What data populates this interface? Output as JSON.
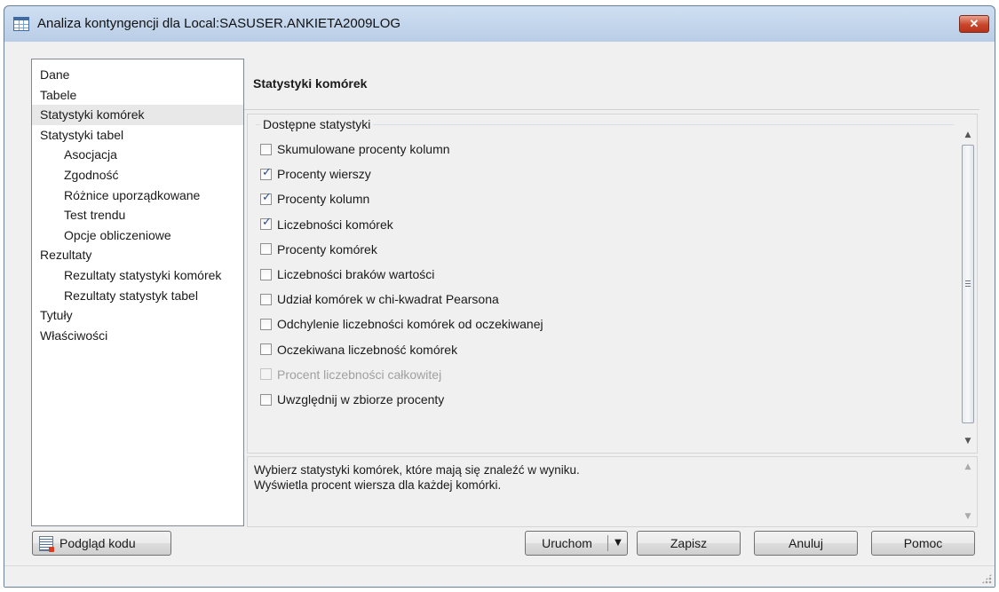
{
  "window": {
    "title": "Analiza kontyngencji dla Local:SASUSER.ANKIETA2009LOG",
    "close_label": "✕"
  },
  "nav": {
    "items": [
      {
        "label": "Dane",
        "level": 0
      },
      {
        "label": "Tabele",
        "level": 0
      },
      {
        "label": "Statystyki komórek",
        "level": 0,
        "selected": true
      },
      {
        "label": "Statystyki tabel",
        "level": 0
      },
      {
        "label": "Asocjacja",
        "level": 1
      },
      {
        "label": "Zgodność",
        "level": 1
      },
      {
        "label": "Różnice uporządkowane",
        "level": 1
      },
      {
        "label": "Test trendu",
        "level": 1
      },
      {
        "label": "Opcje obliczeniowe",
        "level": 1
      },
      {
        "label": "Rezultaty",
        "level": 0
      },
      {
        "label": "Rezultaty statystyki komórek",
        "level": 1
      },
      {
        "label": "Rezultaty statystyk tabel",
        "level": 1
      },
      {
        "label": "Tytuły",
        "level": 0
      },
      {
        "label": "Właściwości",
        "level": 0
      }
    ]
  },
  "main": {
    "title": "Statystyki komórek",
    "group_label": "Dostępne statystyki",
    "options": [
      {
        "label": "Skumulowane procenty kolumn",
        "checked": false,
        "enabled": true
      },
      {
        "label": "Procenty wierszy",
        "checked": true,
        "enabled": true
      },
      {
        "label": "Procenty kolumn",
        "checked": true,
        "enabled": true
      },
      {
        "label": "Liczebności komórek",
        "checked": true,
        "enabled": true
      },
      {
        "label": "Procenty komórek",
        "checked": false,
        "enabled": true
      },
      {
        "label": "Liczebności braków wartości",
        "checked": false,
        "enabled": true
      },
      {
        "label": "Udział komórek w chi-kwadrat Pearsona",
        "checked": false,
        "enabled": true
      },
      {
        "label": "Odchylenie liczebności komórek od oczekiwanej",
        "checked": false,
        "enabled": true
      },
      {
        "label": "Oczekiwana liczebność komórek",
        "checked": false,
        "enabled": true
      },
      {
        "label": "Procent liczebności całkowitej",
        "checked": false,
        "enabled": false
      },
      {
        "label": "Uwzględnij w zbiorze procenty",
        "checked": false,
        "enabled": true
      }
    ]
  },
  "description": {
    "line1": "Wybierz statystyki komórek, które mają się znaleźć w wyniku.",
    "line2": "Wyświetla procent wiersza dla każdej komórki."
  },
  "buttons": {
    "code_preview": "Podgląd kodu",
    "run": "Uruchom",
    "run_dropdown": "▼",
    "save": "Zapisz",
    "cancel": "Anuluj",
    "help": "Pomoc"
  },
  "scroll": {
    "up": "▲",
    "down": "▼"
  }
}
